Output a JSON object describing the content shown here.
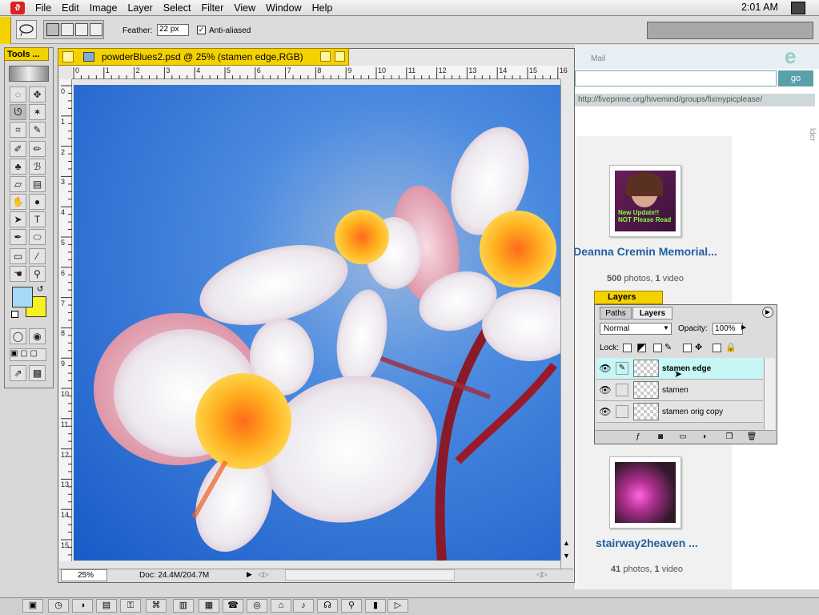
{
  "menubar": {
    "app_icon": "photoshop-eye-icon",
    "items": [
      "File",
      "Edit",
      "Image",
      "Layer",
      "Select",
      "Filter",
      "View",
      "Window",
      "Help"
    ],
    "clock": "2:01 AM"
  },
  "options_bar": {
    "feather_label": "Feather:",
    "feather_value": "22 px",
    "antialias_label": "Anti-aliased",
    "antialias_checked": "✓"
  },
  "tools": {
    "title": "Tools ..."
  },
  "document": {
    "title": "powderBlues2.psd @ 25% (stamen edge,RGB)",
    "zoom": "25%",
    "doc_info": "Doc: 24.4M/204.7M",
    "ruler_top": [
      "0",
      "1",
      "2",
      "3",
      "4",
      "5",
      "6",
      "7",
      "8",
      "9",
      "10",
      "11",
      "12",
      "13",
      "14",
      "15",
      "16"
    ],
    "ruler_left": [
      "0",
      "1",
      "2",
      "3",
      "4",
      "5",
      "6",
      "7",
      "8",
      "9",
      "10",
      "11",
      "12",
      "13",
      "14",
      "15"
    ]
  },
  "browser": {
    "mail_label": "Mail",
    "go_label": "go",
    "url": "http://fiveprime.org/hivemind/groups/fixmypicplease/",
    "side_label": "lder",
    "groups": [
      {
        "title": "Deanna Cremin Memorial...",
        "photos": "500",
        "photos_label": "photos,",
        "videos": "1",
        "videos_label": "video",
        "thumb_caption": "New Update!! NOT Please Read"
      },
      {
        "title": "stairway2heaven ...",
        "photos": "41",
        "photos_label": "photos,",
        "videos": "1",
        "videos_label": "video"
      }
    ]
  },
  "layers": {
    "tab_label": "Layers",
    "tabs": [
      "Paths",
      "Layers"
    ],
    "blend_mode": "Normal",
    "opacity_label": "Opacity:",
    "opacity_value": "100%",
    "lock_label": "Lock:",
    "rows": [
      {
        "name": "stamen edge"
      },
      {
        "name": "stamen"
      },
      {
        "name": "stamen orig copy"
      }
    ]
  },
  "colors": {
    "accent_yellow": "#f4d200",
    "foreground_swatch": "#a8d8f8",
    "background_swatch": "#f8f020",
    "link_blue": "#2060a0"
  }
}
